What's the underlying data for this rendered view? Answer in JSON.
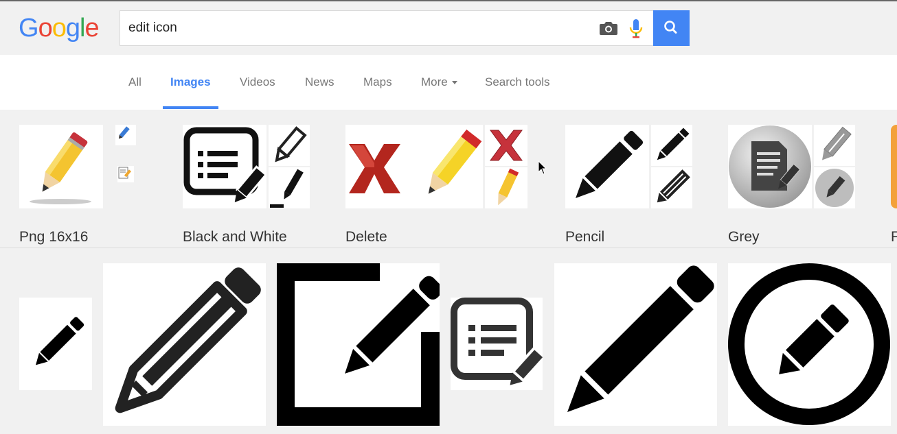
{
  "header": {
    "logo_letters": [
      "G",
      "o",
      "o",
      "g",
      "l",
      "e"
    ],
    "logo_colors": [
      "#4285f4",
      "#ea4335",
      "#fbbc05",
      "#4285f4",
      "#34a853",
      "#ea4335"
    ],
    "search": {
      "value": "edit icon",
      "placeholder": ""
    },
    "icons": {
      "camera": "camera-icon",
      "mic": "mic-icon",
      "search": "search-icon"
    },
    "accent": "#4285f4"
  },
  "nav": {
    "tabs": [
      {
        "label": "All"
      },
      {
        "label": "Images",
        "active": true
      },
      {
        "label": "Videos"
      },
      {
        "label": "News"
      },
      {
        "label": "Maps"
      },
      {
        "label": "More"
      },
      {
        "label": "Search tools"
      }
    ]
  },
  "related": {
    "cards": [
      {
        "label": "Png 16x16"
      },
      {
        "label": "Black and White"
      },
      {
        "label": "Delete"
      },
      {
        "label": "Pencil"
      },
      {
        "label": "Grey"
      },
      {
        "label": "F"
      }
    ]
  },
  "results": {
    "icons": [
      "small-pencil-icon",
      "outlined-pencil-icon",
      "edit-square-icon",
      "list-edit-icon",
      "large-pencil-icon",
      "circle-pencil-icon"
    ]
  }
}
